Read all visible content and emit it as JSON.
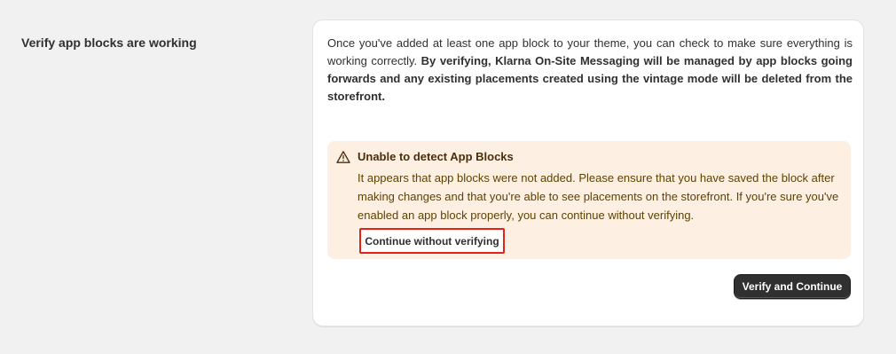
{
  "section": {
    "title": "Verify app blocks are working"
  },
  "card": {
    "intro_text": "Once you've added at least one app block to your theme, you can check to make sure everything is working correctly. ",
    "intro_bold": "By verifying, Klarna On-Site Messaging will be managed by app blocks going forwards and any existing placements created using the vintage mode will be deleted from the storefront.",
    "banner": {
      "icon": "warning-triangle-icon",
      "title": "Unable to detect App Blocks",
      "body": "It appears that app blocks were not added. Please ensure that you have saved the block after making changes and that you're able to see placements on the storefront. If you're sure you've enabled an app block properly, you can continue without verifying.",
      "button_label": "Continue without verifying"
    },
    "primary_button_label": "Verify and Continue"
  },
  "colors": {
    "page_bg": "#f1f1f1",
    "banner_bg": "#fdf0e3",
    "highlight_border": "#e3231b",
    "primary_button_bg": "#303030"
  }
}
